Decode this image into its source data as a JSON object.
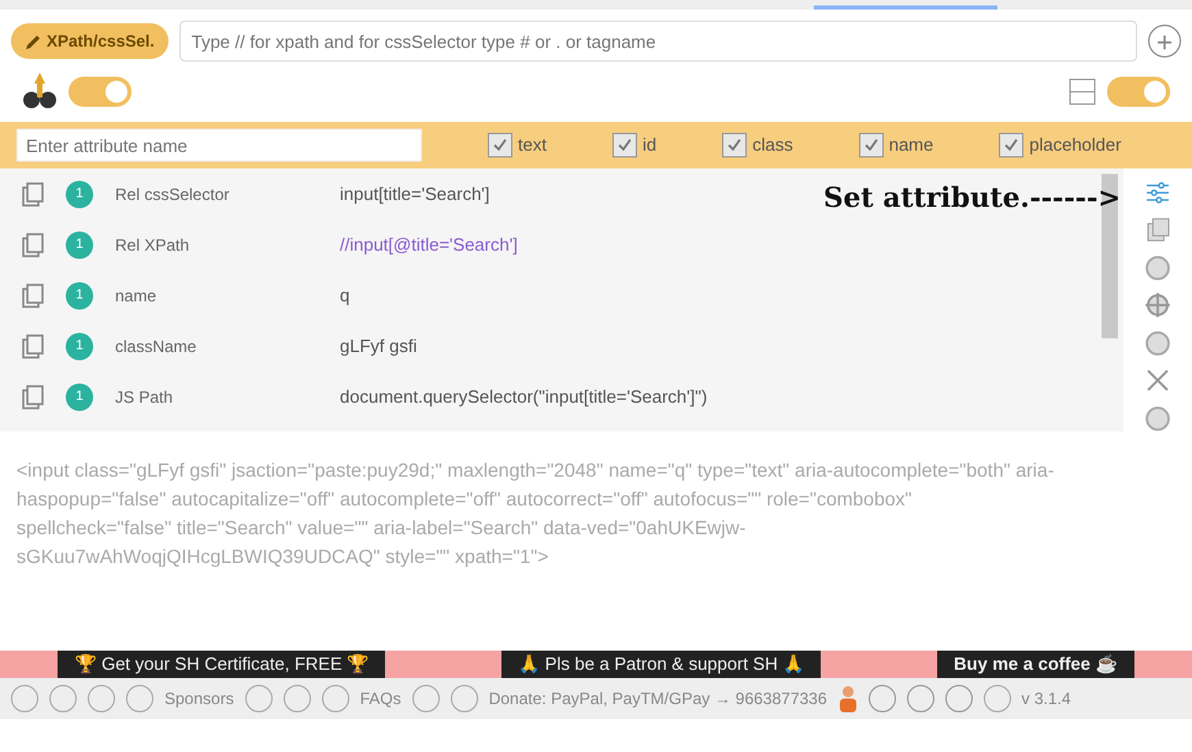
{
  "selector_bar": {
    "mode_button": "XPath/cssSel.",
    "placeholder": "Type // for xpath and for cssSelector type # or . or tagname"
  },
  "toggles": [
    {
      "on": true
    },
    {
      "on": true
    }
  ],
  "attribute_bar": {
    "placeholder": "Enter attribute name",
    "options": [
      {
        "label": "text",
        "checked": true
      },
      {
        "label": "id",
        "checked": true
      },
      {
        "label": "class",
        "checked": true
      },
      {
        "label": "name",
        "checked": true
      },
      {
        "label": "placeholder",
        "checked": true
      }
    ]
  },
  "results": [
    {
      "count": "1",
      "label": "Rel cssSelector",
      "value": "input[title='Search']",
      "kind": "plain"
    },
    {
      "count": "1",
      "label": "Rel XPath",
      "value": "//input[@title='Search']",
      "kind": "xpath"
    },
    {
      "count": "1",
      "label": "name",
      "value": "q",
      "kind": "plain"
    },
    {
      "count": "1",
      "label": "className",
      "value": "gLFyf gsfi",
      "kind": "plain"
    },
    {
      "count": "1",
      "label": "JS Path",
      "value": "document.querySelector(\"input[title='Search']\")",
      "kind": "plain"
    }
  ],
  "annotation": "Set attribute.------>",
  "outer_html": "<input class=\"gLFyf gsfi\" jsaction=\"paste:puy29d;\" maxlength=\"2048\" name=\"q\" type=\"text\" aria-autocomplete=\"both\" aria-haspopup=\"false\" autocapitalize=\"off\" autocomplete=\"off\" autocorrect=\"off\" autofocus=\"\" role=\"combobox\" spellcheck=\"false\" title=\"Search\" value=\"\" aria-label=\"Search\" data-ved=\"0ahUKEwjw-sGKuu7wAhWoqjQIHcgLBWIQ39UDCAQ\" style=\"\" xpath=\"1\">",
  "banners": [
    "🏆 Get your SH Certificate, FREE 🏆",
    "🙏 Pls be a Patron & support SH 🙏",
    "Buy me a coffee ☕"
  ],
  "footer": {
    "sponsors": "Sponsors",
    "faqs": "FAQs",
    "donate": "Donate: PayPal, PayTM/GPay → 9663877336",
    "version": "v 3.1.4"
  }
}
